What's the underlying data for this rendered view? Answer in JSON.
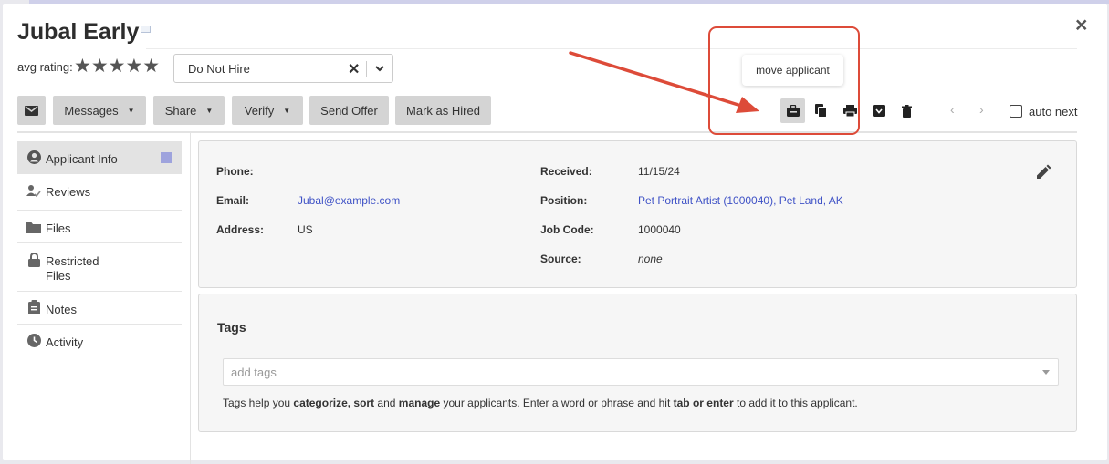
{
  "applicant": {
    "name": "Jubal Early",
    "avg_rating_label": "avg rating:",
    "stars": "★★★★★",
    "status_value": "Do Not Hire",
    "status_clear": "✕"
  },
  "toolbar": {
    "messages": "Messages",
    "share": "Share",
    "verify": "Verify",
    "send_offer": "Send Offer",
    "mark_hired": "Mark as Hired",
    "auto_next": "auto next",
    "prev": "‹",
    "next": "›",
    "close": "×",
    "tooltip": "move applicant",
    "icons": [
      "email-icon",
      "move-applicant-icon",
      "copy-icon",
      "print-icon",
      "archive-icon",
      "trash-icon"
    ]
  },
  "sidebar": {
    "items": [
      {
        "label": "Applicant Info",
        "icon": "person-icon"
      },
      {
        "label": "Reviews",
        "icon": "reviews-icon"
      },
      {
        "label": "Files",
        "icon": "folder-icon"
      },
      {
        "label": "Restricted",
        "label2": "Files",
        "icon": "lock-icon"
      },
      {
        "label": "Notes",
        "icon": "clipboard-icon"
      },
      {
        "label": "Activity",
        "icon": "clock-icon"
      }
    ]
  },
  "info": {
    "phone_label": "Phone:",
    "phone": "",
    "email_label": "Email:",
    "email": "Jubal@example.com",
    "address_label": "Address:",
    "address": "US",
    "received_label": "Received:",
    "received": "11/15/24",
    "position_label": "Position:",
    "position": "Pet Portrait Artist (1000040), Pet Land, AK",
    "jobcode_label": "Job Code:",
    "jobcode": "1000040",
    "source_label": "Source:",
    "source": "none"
  },
  "tags": {
    "title": "Tags",
    "placeholder": "add tags",
    "help_1": "Tags help you ",
    "help_b1": "categorize, sort",
    "help_2": " and ",
    "help_b2": "manage",
    "help_3": " your applicants. Enter a word or phrase and hit ",
    "help_b3": "tab or enter",
    "help_4": " to add it to this applicant."
  },
  "colors": {
    "annotation_red": "#dd4b39",
    "link_blue": "#3f52c6",
    "indicator": "#9ea3dd"
  }
}
